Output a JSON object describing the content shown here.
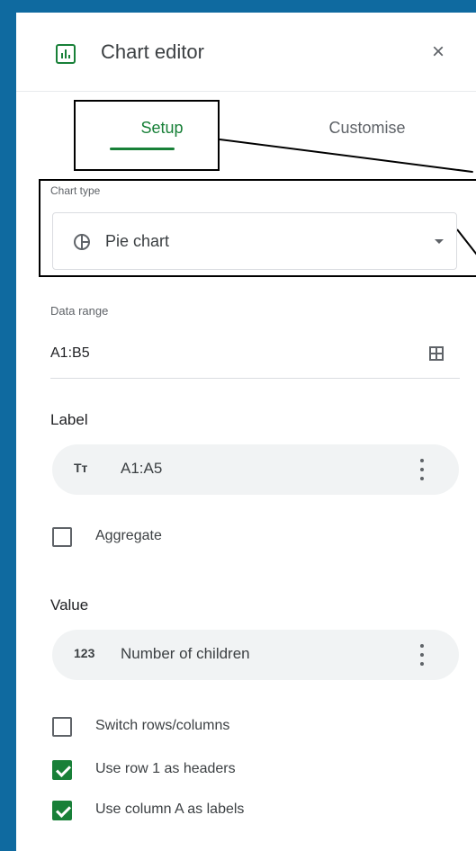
{
  "header": {
    "title": "Chart editor",
    "close_glyph": "×"
  },
  "tabs": [
    {
      "label": "Setup",
      "active": true
    },
    {
      "label": "Customise",
      "active": false
    }
  ],
  "chart_type": {
    "label": "Chart type",
    "value": "Pie chart",
    "icon": "pie-chart-icon"
  },
  "data_range": {
    "label": "Data range",
    "value": "A1:B5",
    "icon": "grid-select-icon"
  },
  "label_section": {
    "title": "Label",
    "field_icon": "Tт",
    "field_value": "A1:A5"
  },
  "aggregate": {
    "label": "Aggregate",
    "checked": false
  },
  "value_section": {
    "title": "Value",
    "field_icon": "123",
    "field_value": "Number of children"
  },
  "options": [
    {
      "label": "Switch rows/columns",
      "checked": false
    },
    {
      "label": "Use row 1 as headers",
      "checked": true
    },
    {
      "label": "Use column A as labels",
      "checked": true
    }
  ],
  "colors": {
    "accent": "#188038",
    "frame": "#0f6aa0",
    "pill_bg": "#f1f3f4"
  }
}
